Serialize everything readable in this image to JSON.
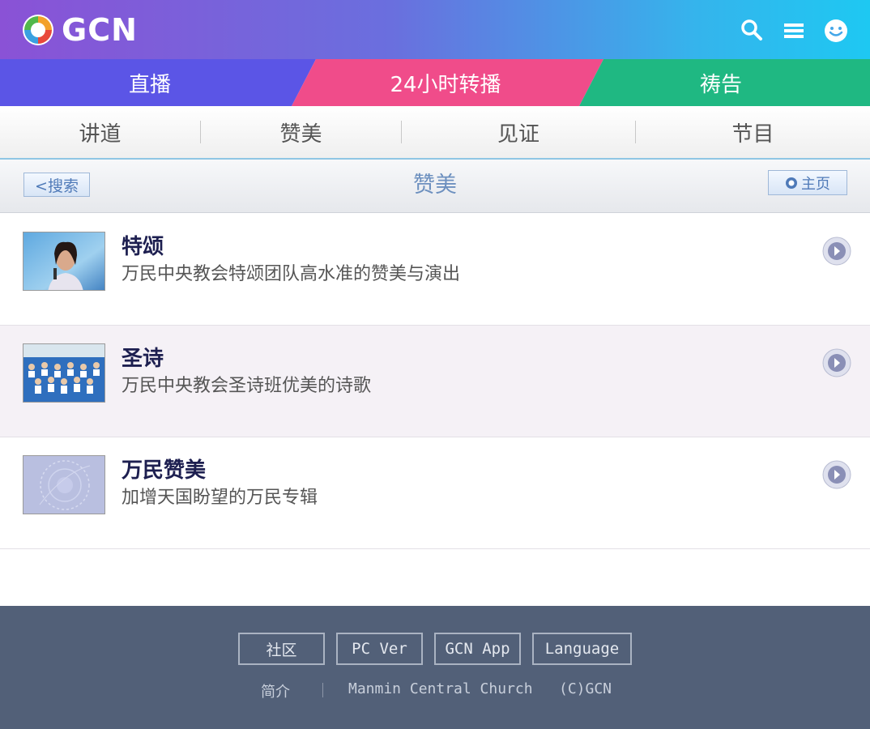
{
  "header": {
    "logo_text": "GCN",
    "icons": [
      "search-icon",
      "menu-icon",
      "smiley-icon"
    ]
  },
  "main_tabs": [
    {
      "label": "直播",
      "color": "#5b55e6"
    },
    {
      "label": "24小时转播",
      "color": "#f04c8a"
    },
    {
      "label": "祷告",
      "color": "#1fb882"
    }
  ],
  "sub_tabs": [
    {
      "label": "讲道"
    },
    {
      "label": "赞美"
    },
    {
      "label": "见证"
    },
    {
      "label": "节目"
    }
  ],
  "title_bar": {
    "back_label": "<搜索",
    "title": "赞美",
    "home_label": "主页"
  },
  "items": [
    {
      "title": "特颂",
      "desc": "万民中央教会特颂团队高水准的赞美与演出",
      "thumb": "singer-photo"
    },
    {
      "title": "圣诗",
      "desc": "万民中央教会圣诗班优美的诗歌",
      "thumb": "choir-photo"
    },
    {
      "title": "万民赞美",
      "desc": "加增天国盼望的万民专辑",
      "thumb": "album-cover"
    }
  ],
  "footer": {
    "buttons": [
      "社区",
      "PC Ver",
      "GCN App",
      "Language"
    ],
    "info": [
      "简介",
      "Manmin Central Church",
      "(C)GCN"
    ]
  },
  "colors": {
    "header_start": "#8a52d6",
    "header_end": "#1ec8f2",
    "footer_bg": "#526078",
    "title_blue": "#6d90bf"
  }
}
